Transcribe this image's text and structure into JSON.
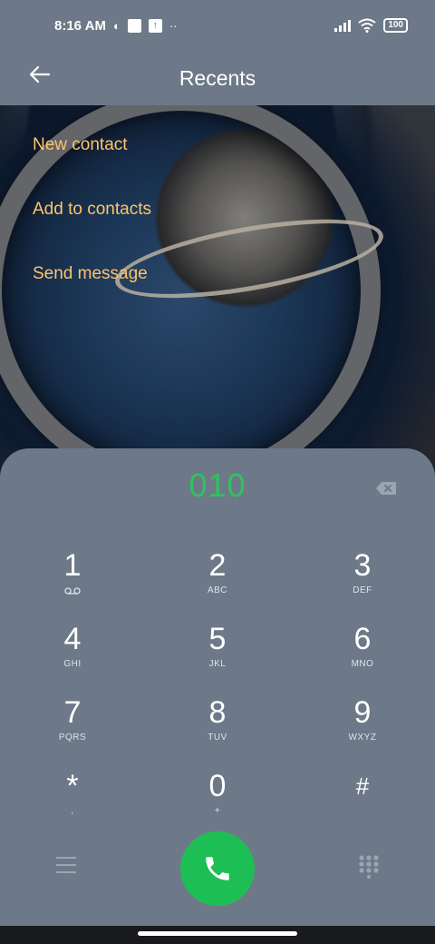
{
  "status_bar": {
    "time": "8:16 AM",
    "battery": "100"
  },
  "header": {
    "title": "Recents",
    "back_icon": "arrow-left-icon"
  },
  "menu": {
    "items": [
      {
        "label": "New contact"
      },
      {
        "label": "Add to contacts"
      },
      {
        "label": "Send message"
      }
    ]
  },
  "dialer": {
    "number": "010",
    "keys": [
      {
        "digit": "1",
        "letters": ""
      },
      {
        "digit": "2",
        "letters": "ABC"
      },
      {
        "digit": "3",
        "letters": "DEF"
      },
      {
        "digit": "4",
        "letters": "GHI"
      },
      {
        "digit": "5",
        "letters": "JKL"
      },
      {
        "digit": "6",
        "letters": "MNO"
      },
      {
        "digit": "7",
        "letters": "PQRS"
      },
      {
        "digit": "8",
        "letters": "TUV"
      },
      {
        "digit": "9",
        "letters": "WXYZ"
      },
      {
        "digit": "*",
        "letters": ","
      },
      {
        "digit": "0",
        "letters": "+"
      },
      {
        "digit": "#",
        "letters": ""
      }
    ]
  },
  "colors": {
    "accent_orange": "#ffc46b",
    "number_green": "#2ec35c",
    "call_green": "#1dbf55",
    "panel": "#6d7988"
  }
}
